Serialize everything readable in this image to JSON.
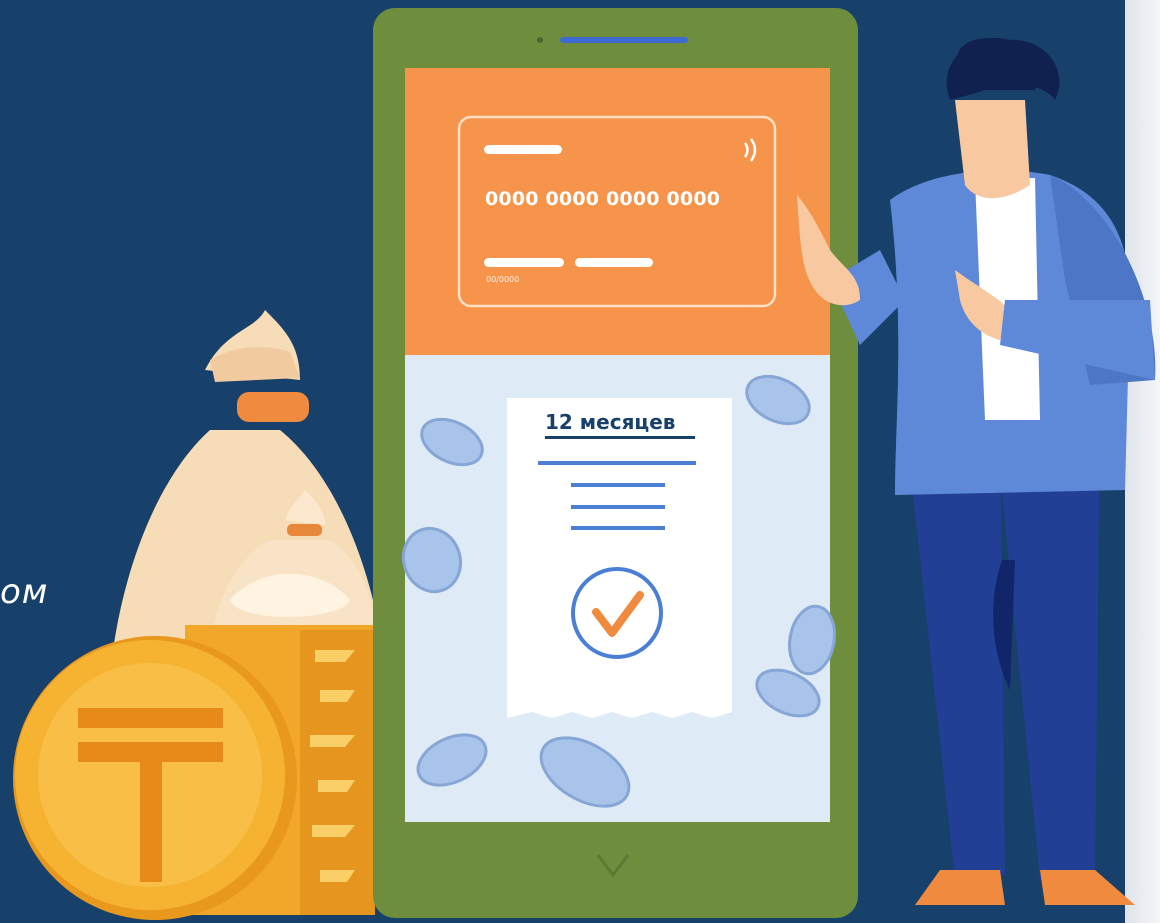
{
  "caption": {
    "text": "ом"
  },
  "phone": {
    "card": {
      "number": "0000 0000 0000 0000",
      "expiry": "00/0000"
    },
    "receipt": {
      "title": "12 месяцев",
      "status": "check-icon"
    }
  },
  "colors": {
    "background": "#17406a",
    "phone_body": "#6e8e3e",
    "screen_top": "#f5944a",
    "screen_bottom": "#dfeaf7",
    "coin_gold": "#f6b332",
    "accent_blue": "#4a7fd4"
  },
  "icons": [
    "tenge-coin-icon",
    "money-bag-icon",
    "dollar-coin-icon",
    "check-icon",
    "contactless-icon"
  ]
}
